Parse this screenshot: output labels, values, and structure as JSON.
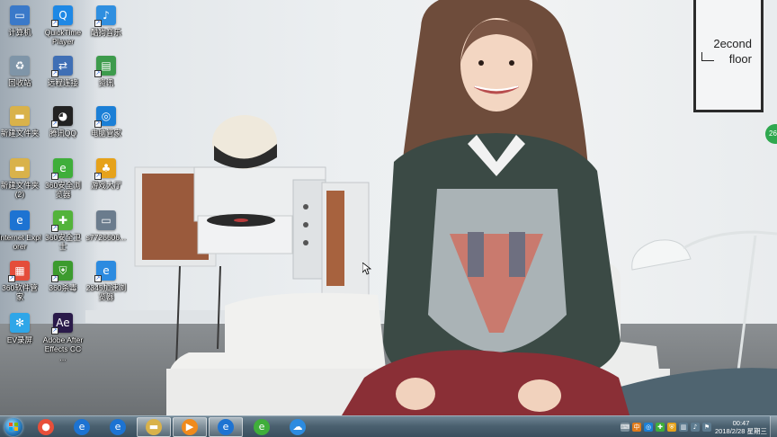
{
  "wallpaper": {
    "logo_line1": "2econd",
    "logo_line2": "floor",
    "badge": "26"
  },
  "desktop_icons": [
    {
      "key": "computer",
      "label": "计算机",
      "icon": "computer-icon",
      "color": "#3a79c9",
      "glyph": "▭",
      "shortcut": false
    },
    {
      "key": "quicktime",
      "label": "QuickTime Player",
      "icon": "quicktime-icon",
      "color": "#1e88e5",
      "glyph": "Q",
      "shortcut": true
    },
    {
      "key": "music",
      "label": "酷狗音乐",
      "icon": "music-app-icon",
      "color": "#2f8fe0",
      "glyph": "♪",
      "shortcut": true
    },
    {
      "key": "recycle",
      "label": "回收站",
      "icon": "recycle-bin-icon",
      "color": "#7f95a8",
      "glyph": "♻",
      "shortcut": false
    },
    {
      "key": "remote",
      "label": "远程连接",
      "icon": "remote-desktop-icon",
      "color": "#3f6fb5",
      "glyph": "⇄",
      "shortcut": true
    },
    {
      "key": "news",
      "label": "资讯",
      "icon": "news-icon",
      "color": "#3d9b4c",
      "glyph": "▤",
      "shortcut": true
    },
    {
      "key": "newfolder",
      "label": "新建文件夹",
      "icon": "folder-icon",
      "color": "#d9b24a",
      "glyph": "▬",
      "shortcut": false
    },
    {
      "key": "qq",
      "label": "腾讯QQ",
      "icon": "qq-icon",
      "color": "#222222",
      "glyph": "◕",
      "shortcut": true
    },
    {
      "key": "pcmgr",
      "label": "电脑管家",
      "icon": "pc-manager-icon",
      "color": "#1b7fd6",
      "glyph": "◎",
      "shortcut": true
    },
    {
      "key": "newfolder2",
      "label": "新建文件夹 (2)",
      "icon": "folder-icon",
      "color": "#d9b24a",
      "glyph": "▬",
      "shortcut": false
    },
    {
      "key": "browser360",
      "label": "360安全浏览器",
      "icon": "360-browser-icon",
      "color": "#3fae3a",
      "glyph": "e",
      "shortcut": true
    },
    {
      "key": "games",
      "label": "游戏大厅",
      "icon": "games-icon",
      "color": "#e6a21a",
      "glyph": "♣",
      "shortcut": true
    },
    {
      "key": "ie",
      "label": "Internet Explorer",
      "icon": "internet-explorer-icon",
      "color": "#1d73d2",
      "glyph": "e",
      "shortcut": false
    },
    {
      "key": "guard360",
      "label": "360安全卫士",
      "icon": "360-guard-icon",
      "color": "#53b33a",
      "glyph": "✚",
      "shortcut": true
    },
    {
      "key": "file",
      "label": "s7726606...",
      "icon": "file-icon",
      "color": "#6b7c8d",
      "glyph": "▭",
      "shortcut": false
    },
    {
      "key": "soft360",
      "label": "360软件管家",
      "icon": "360-software-icon",
      "color": "#e44d3a",
      "glyph": "▦",
      "shortcut": true
    },
    {
      "key": "av360",
      "label": "360杀毒",
      "icon": "360-antivirus-icon",
      "color": "#3c9b2e",
      "glyph": "⛨",
      "shortcut": true
    },
    {
      "key": "browser2345",
      "label": "2345加速浏览器",
      "icon": "2345-browser-icon",
      "color": "#2c8be0",
      "glyph": "e",
      "shortcut": true
    },
    {
      "key": "ev",
      "label": "EV录屏",
      "icon": "ev-recorder-icon",
      "color": "#2fa6e8",
      "glyph": "✻",
      "shortcut": false
    },
    {
      "key": "ae",
      "label": "Adobe After Effects CC ...",
      "icon": "after-effects-icon",
      "color": "#2a1a4a",
      "glyph": "Ae",
      "shortcut": true
    }
  ],
  "taskbar": {
    "start": "start-orb-icon",
    "pinned": [
      {
        "key": "apps",
        "icon": "colorful-apps-icon",
        "color": "#e84f3a",
        "glyph": "●",
        "active": false
      },
      {
        "key": "ie1",
        "icon": "internet-explorer-icon",
        "color": "#1d73d2",
        "glyph": "e",
        "active": false
      },
      {
        "key": "ie2",
        "icon": "internet-explorer-icon",
        "color": "#1d73d2",
        "glyph": "e",
        "active": false
      },
      {
        "key": "explorer",
        "icon": "file-explorer-icon",
        "color": "#d9b24a",
        "glyph": "▬",
        "active": true
      },
      {
        "key": "media",
        "icon": "media-player-icon",
        "color": "#f08a1c",
        "glyph": "▶",
        "active": true
      },
      {
        "key": "ie3",
        "icon": "internet-explorer-icon",
        "color": "#1d73d2",
        "glyph": "e",
        "active": true
      },
      {
        "key": "browser360",
        "icon": "360-browser-icon",
        "color": "#3fae3a",
        "glyph": "e",
        "active": false
      },
      {
        "key": "cloud",
        "icon": "baidu-cloud-icon",
        "color": "#2c8be0",
        "glyph": "☁",
        "active": false
      }
    ],
    "tray_icons": [
      {
        "icon": "keyboard-icon",
        "color": "#7b8d99",
        "glyph": "⌨"
      },
      {
        "icon": "input-method-icon",
        "color": "#e07b1a",
        "glyph": "中"
      },
      {
        "icon": "pc-manager-tray-icon",
        "color": "#1b7fd6",
        "glyph": "◎"
      },
      {
        "icon": "360-tray-icon",
        "color": "#3fae3a",
        "glyph": "✚"
      },
      {
        "icon": "security-tray-icon",
        "color": "#e6a21a",
        "glyph": "⛨"
      },
      {
        "icon": "network-icon",
        "color": "#5d7b8f",
        "glyph": "▥"
      },
      {
        "icon": "volume-icon",
        "color": "#5d7b8f",
        "glyph": "♪"
      },
      {
        "icon": "action-center-icon",
        "color": "#5d7b8f",
        "glyph": "⚑"
      }
    ],
    "time": "00:47",
    "date": "2018/2/28 星期三"
  }
}
